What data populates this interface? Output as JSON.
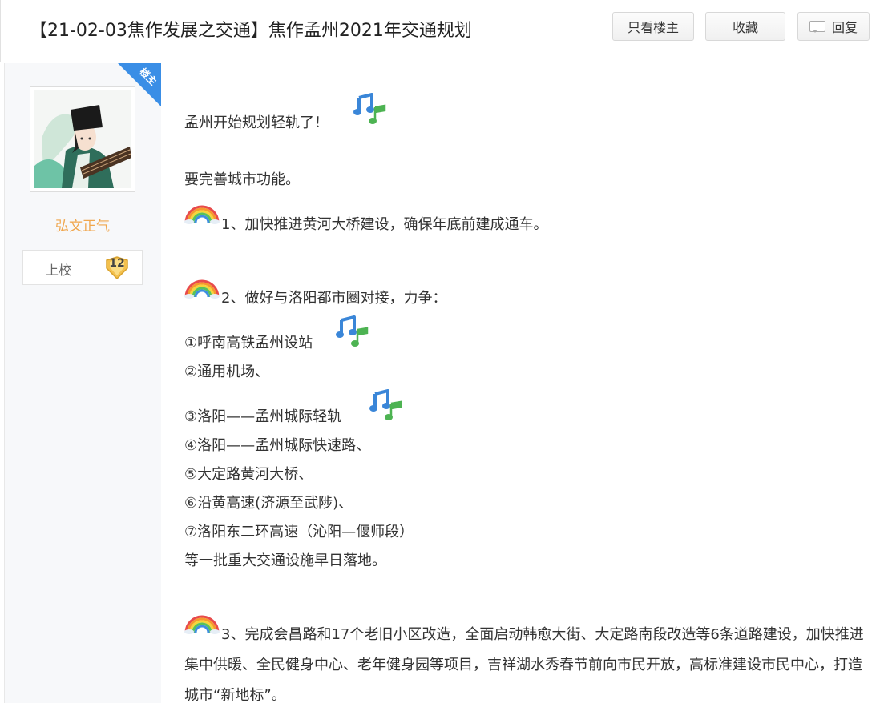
{
  "header": {
    "title": "【21-02-03焦作发展之交通】焦作孟州2021年交通规划",
    "btn_only_op": "只看楼主",
    "btn_favorite": "收藏",
    "btn_reply": "回复"
  },
  "author": {
    "corner_tag": "楼主",
    "name": "弘文正气",
    "rank": "上校",
    "level": "12"
  },
  "post": {
    "l1": "孟州开始规划轻轨了！",
    "l2": "要完善城市功能。",
    "l3": "1、加快推进黄河大桥建设，确保年底前建成通车。",
    "l4": "2、做好与洛阳都市圈对接，力争：",
    "l5": "①呼南高铁孟州设站",
    "l6": "②通用机场、",
    "l7": "③洛阳——孟州城际轻轨",
    "l8": "④洛阳——孟州城际快速路、",
    "l9": "⑤大定路黄河大桥、",
    "l10": "⑥沿黄高速(济源至武陟)、",
    "l11": "⑦洛阳东二环高速（沁阳—偃师段）",
    "l12": "等一批重大交通设施早日落地。",
    "l13": "3、完成会昌路和17个老旧小区改造，全面启动韩愈大街、大定路南段改造等6条道路建设，加快推进集中供暖、全民健身中心、老年健身园等项目，吉祥湖水秀春节前向市民开放，高标准建设市民中心，打造城市“新地标”。"
  },
  "icons": {
    "note": "music-note-emoji-icon",
    "rainbow": "rainbow-emoji-icon",
    "reply": "speech-bubble-icon"
  }
}
